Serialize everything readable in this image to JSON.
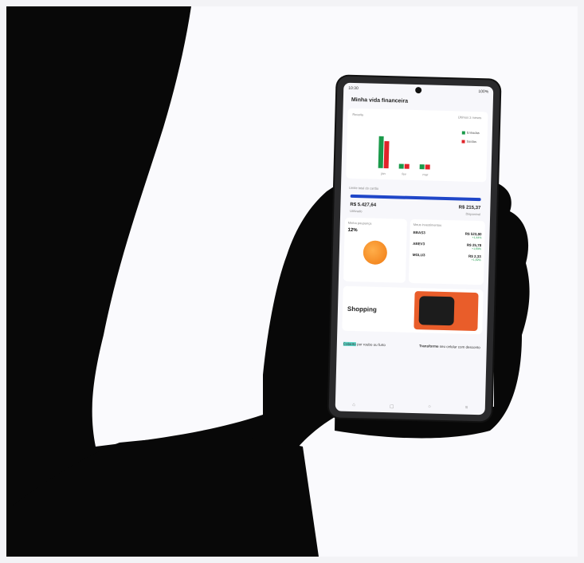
{
  "screen": {
    "status_time": "10:30",
    "status_battery": "100%",
    "title": "Minha vida financeira",
    "chart_card": {
      "label": "Receita",
      "period": "Últimos 3 meses",
      "ticks": [
        "jan",
        "fev",
        "mar"
      ],
      "legend": [
        "Entradas",
        "Saídas"
      ],
      "colors": {
        "in": "#1a9a4a",
        "out": "#e0242a"
      }
    },
    "balance": {
      "label": "Limite total do cartão",
      "used": "R$ 5.427,64",
      "used_label": "Utilizado",
      "available": "R$ 215,37",
      "available_label": "Disponível"
    },
    "savings": {
      "label": "Minha poupança",
      "value": "12%"
    },
    "stocks": {
      "label": "Meus investimentos",
      "items": [
        {
          "ticker": "BBAS3",
          "price": "R$ 523,80",
          "change": "+1,44%"
        },
        {
          "ticker": "ABEV3",
          "price": "R$ 25,78",
          "change": "+1,69%"
        },
        {
          "ticker": "MGLU3",
          "price": "R$ 2,33",
          "change": "+1,82%"
        }
      ]
    },
    "shopping": {
      "title": "Shopping"
    },
    "promos": [
      {
        "lead": "Coberto",
        "text": "por roubo ou furto"
      },
      {
        "lead": "Transforme",
        "text": "seu celular com desconto"
      }
    ]
  }
}
